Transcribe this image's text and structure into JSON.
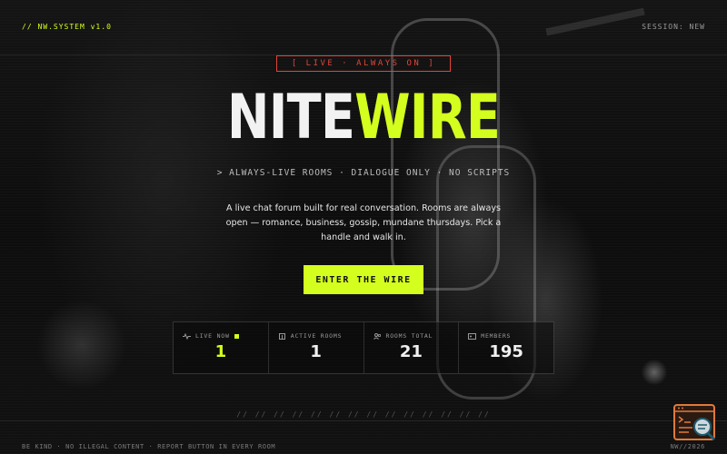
{
  "header": {
    "system_label": "// NW.SYSTEM v1.0",
    "session_label": "SESSION: NEW"
  },
  "hero": {
    "badge": "[ LIVE · ALWAYS ON ]",
    "logo_part1": "NITE",
    "logo_part2": "WIRE",
    "tagline": "> ALWAYS-LIVE ROOMS · DIALOGUE ONLY · NO SCRIPTS",
    "description": "A live chat forum built for real conversation. Rooms are always open — romance, business, gossip, mundane thursdays. Pick a handle and walk in.",
    "cta_label": "ENTER THE WIRE"
  },
  "stats": [
    {
      "label": "LIVE NOW",
      "value": "1",
      "icon": "wave-icon"
    },
    {
      "label": "ACTIVE ROOMS",
      "value": "1",
      "icon": "building-icon"
    },
    {
      "label": "ROOMS TOTAL",
      "value": "21",
      "icon": "users-icon"
    },
    {
      "label": "MEMBERS",
      "value": "195",
      "icon": "id-card-icon"
    }
  ],
  "divider": "// // // // // // // // // // // // // //",
  "footer": {
    "rules": "BE KIND · NO ILLEGAL CONTENT · REPORT BUTTON IN EVERY ROOM",
    "copyright": "NW//2026"
  },
  "colors": {
    "accent": "#d4ff1e",
    "live_badge": "#e0453a",
    "background": "#0b0b0b",
    "widget": "#e07a3a"
  }
}
